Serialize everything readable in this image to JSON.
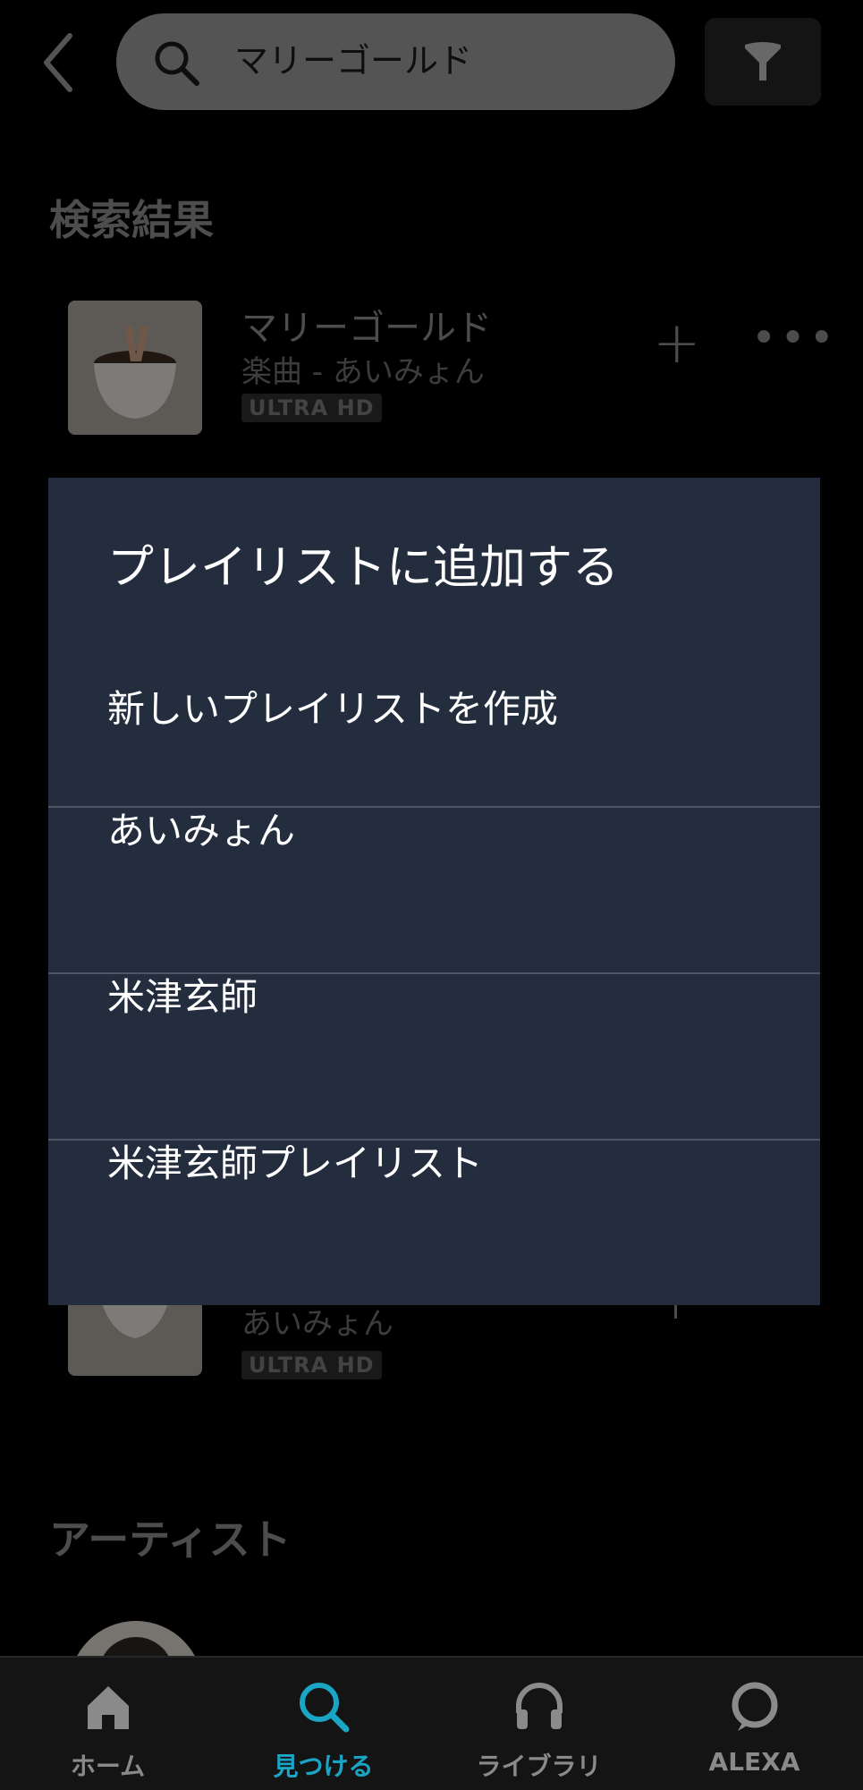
{
  "header": {
    "search_value": "マリーゴールド"
  },
  "results_title": "検索結果",
  "tracks": [
    {
      "title": "マリーゴールド",
      "subtitle": "楽曲 - あいみょん",
      "badge": "ULTRA HD"
    },
    {
      "title": "",
      "subtitle": "あいみょん",
      "badge": "ULTRA HD"
    }
  ],
  "artists_title": "アーティスト",
  "dialog": {
    "title": "プレイリストに追加する",
    "options": [
      {
        "label": "新しいプレイリストを作成"
      },
      {
        "label": "あいみょん"
      },
      {
        "label": "米津玄師"
      },
      {
        "label": "米津玄師プレイリスト"
      }
    ]
  },
  "nav": {
    "items": [
      {
        "label": "ホーム",
        "icon": "home-icon"
      },
      {
        "label": "見つける",
        "icon": "search-icon"
      },
      {
        "label": "ライブラリ",
        "icon": "headphones-icon"
      },
      {
        "label": "ALEXA",
        "icon": "alexa-icon"
      }
    ],
    "active_color": "#1ba5c4"
  }
}
